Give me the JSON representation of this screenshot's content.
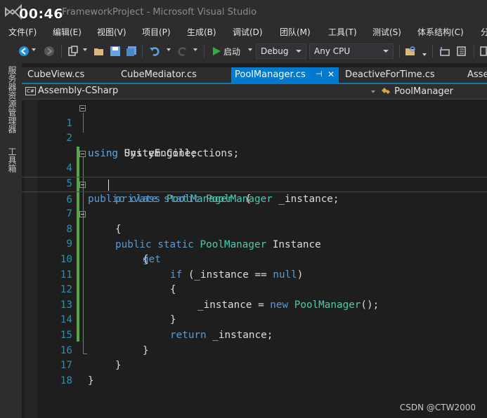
{
  "overlay": {
    "timer": "00:46"
  },
  "window": {
    "title": "FrameworkProject - Microsoft Visual Studio"
  },
  "menu": [
    "文件(F)",
    "编辑(E)",
    "视图(V)",
    "项目(P)",
    "生成(B)",
    "调试(D)",
    "团队(M)",
    "工具(T)",
    "测试(S)",
    "体系结构(C)",
    "分"
  ],
  "toolbar": {
    "start_label": "启动",
    "config": "Debug",
    "platform": "Any CPU"
  },
  "side_panels": [
    "服务器资源管理器",
    "工具箱"
  ],
  "tabs": [
    {
      "label": "CubeView.cs",
      "active": false
    },
    {
      "label": "CubeMediator.cs",
      "active": false
    },
    {
      "label": "PoolManager.cs",
      "active": true,
      "pin": "⊣",
      "close": "✕"
    },
    {
      "label": "DeactiveForTime.cs",
      "active": false
    },
    {
      "label": "Asse",
      "active": false
    }
  ],
  "navbar": {
    "project_badge": "C#",
    "project": "Assembly-CSharp",
    "type": "PoolManager"
  },
  "code": {
    "line_numbers": [
      "1",
      "2",
      "4",
      "5",
      "6",
      "7",
      "8",
      "9",
      "10",
      "11",
      "12",
      "13",
      "14",
      "15",
      "16",
      "17",
      "18"
    ],
    "lines": [
      [
        "using",
        " UnityEngine;"
      ],
      [
        "using",
        " System.Collections;"
      ],
      [
        "public",
        " ",
        "class",
        " ",
        "PoolManager",
        "  {"
      ],
      [
        "private",
        " ",
        "static",
        " ",
        "PoolManager",
        " _instance;"
      ],
      [
        "public",
        " ",
        "static",
        " ",
        "PoolManager",
        " Instance"
      ],
      [
        "{"
      ],
      [
        "get"
      ],
      [
        "{"
      ],
      [
        "if",
        " (_instance == ",
        "null",
        ")"
      ],
      [
        "{"
      ],
      [
        "_instance = ",
        "new",
        " ",
        "PoolManager",
        "();"
      ],
      [
        "}"
      ],
      [
        "return",
        " _instance;"
      ],
      [
        "}"
      ],
      [
        "}"
      ],
      [
        "}"
      ]
    ]
  },
  "watermark": "CSDN @CTW2000",
  "colors": {
    "keyword": "#569cd6",
    "type": "#4ec9b0",
    "line_number": "#2b91af",
    "accent": "#007acc",
    "change_bar": "#57a64a"
  }
}
